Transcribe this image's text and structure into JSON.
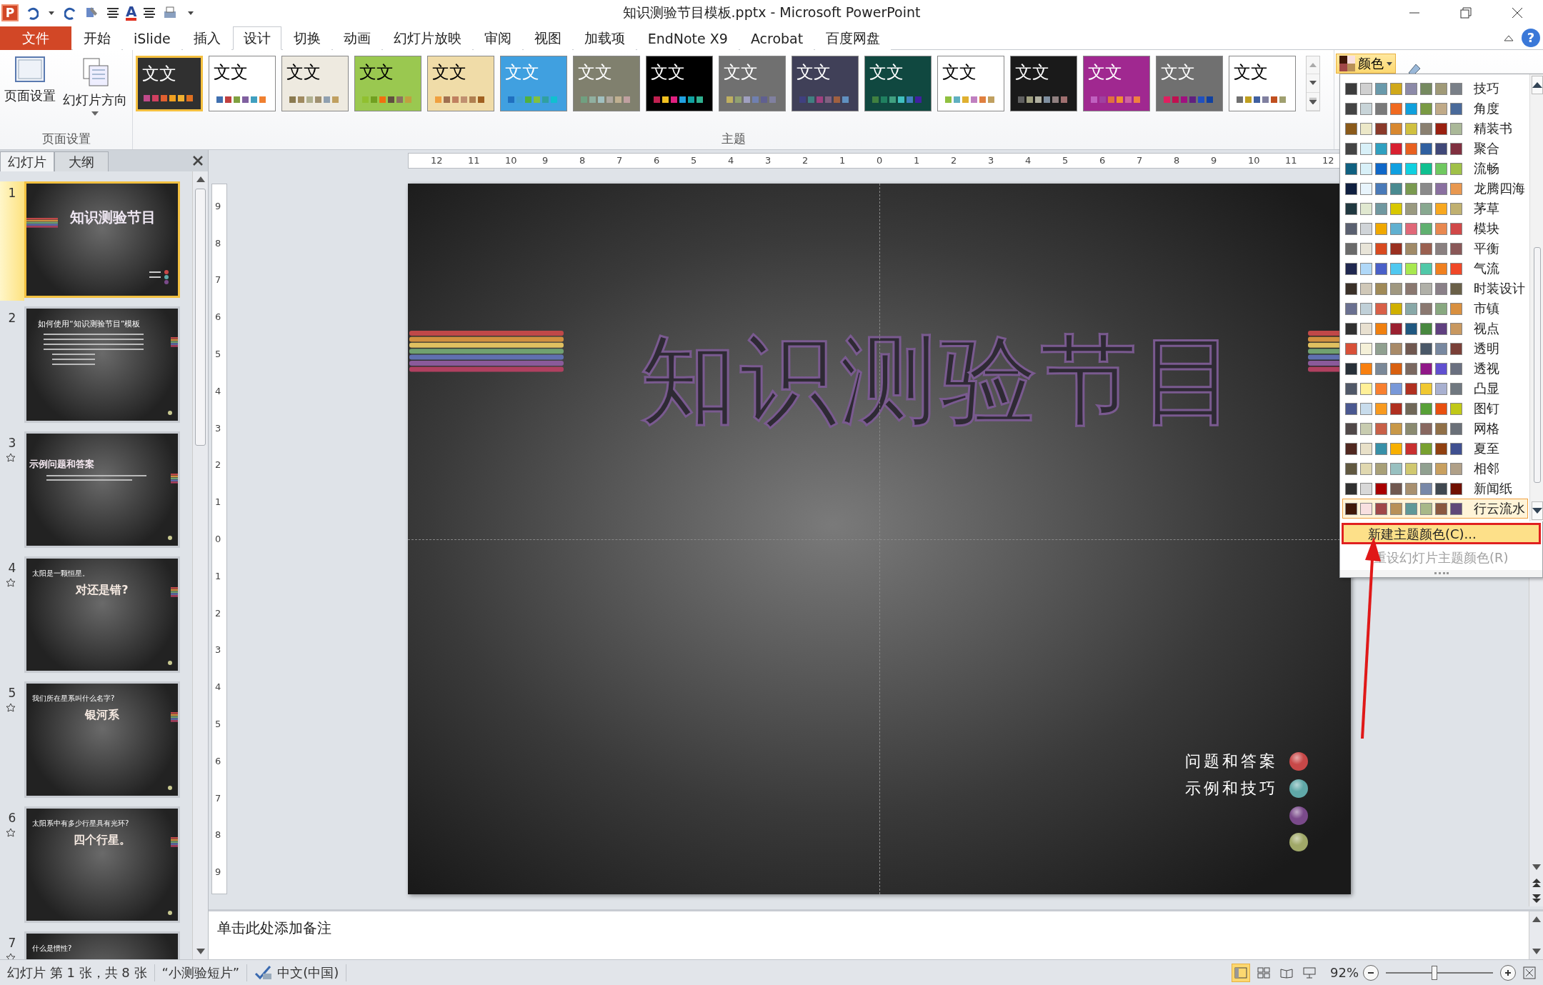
{
  "quick_access": [
    {
      "kind": "logo",
      "letter": "P"
    },
    {
      "kind": "undo"
    },
    {
      "kind": "caret"
    },
    {
      "kind": "redo"
    },
    {
      "kind": "tool"
    },
    {
      "kind": "align"
    },
    {
      "kind": "font-color",
      "letter": "A"
    },
    {
      "kind": "align"
    },
    {
      "kind": "printer"
    },
    {
      "kind": "caret"
    }
  ],
  "window": {
    "title": "知识测验节目模板.pptx - Microsoft PowerPoint",
    "help": "?"
  },
  "tabs": [
    {
      "label": "文件",
      "kind": "file",
      "selected": false
    },
    {
      "label": "开始",
      "kind": "tab",
      "selected": false
    },
    {
      "label": "iSlide",
      "kind": "tab",
      "selected": false
    },
    {
      "label": "插入",
      "kind": "tab",
      "selected": false
    },
    {
      "label": "设计",
      "kind": "tab",
      "selected": true
    },
    {
      "label": "切换",
      "kind": "tab",
      "selected": false
    },
    {
      "label": "动画",
      "kind": "tab",
      "selected": false
    },
    {
      "label": "幻灯片放映",
      "kind": "tab",
      "selected": false
    },
    {
      "label": "审阅",
      "kind": "tab",
      "selected": false
    },
    {
      "label": "视图",
      "kind": "tab",
      "selected": false
    },
    {
      "label": "加载项",
      "kind": "tab",
      "selected": false
    },
    {
      "label": "EndNote X9",
      "kind": "tab",
      "selected": false
    },
    {
      "label": "Acrobat",
      "kind": "tab",
      "selected": false
    },
    {
      "label": "百度网盘",
      "kind": "tab",
      "selected": false
    }
  ],
  "page_setup": {
    "buttons": [
      {
        "label": "页面设置",
        "kind": "setup"
      },
      {
        "label": "幻灯片方向",
        "kind": "orientation"
      }
    ],
    "group_label": "页面设置"
  },
  "themes": {
    "group_label": "主题",
    "items": [
      {
        "label": "文文",
        "selected": true,
        "color": "#303030",
        "swatches": [
          {
            "color": "#c04a8a"
          },
          {
            "color": "#d04060"
          },
          {
            "color": "#e06030"
          },
          {
            "color": "#f0a020"
          },
          {
            "color": "#f0b030"
          },
          {
            "color": "#e07020"
          }
        ]
      },
      {
        "label": "文文",
        "selected": false,
        "color": "#ffffff",
        "swatches": [
          {
            "color": "#4070b0"
          },
          {
            "color": "#c04040"
          },
          {
            "color": "#80a040"
          },
          {
            "color": "#8060a0"
          },
          {
            "color": "#40a0c0"
          },
          {
            "color": "#f08030"
          }
        ]
      },
      {
        "label": "文文",
        "selected": false,
        "color": "#eeeae0",
        "swatches": [
          {
            "color": "#8a7a50"
          },
          {
            "color": "#a08a60"
          },
          {
            "color": "#b0b090"
          },
          {
            "color": "#a09070"
          },
          {
            "color": "#90a0b0"
          },
          {
            "color": "#c0a060"
          }
        ]
      },
      {
        "label": "文文",
        "selected": false,
        "color": "#9ac850",
        "swatches": [
          {
            "color": "#90c030"
          },
          {
            "color": "#70a020"
          },
          {
            "color": "#f07010"
          },
          {
            "color": "#605040"
          },
          {
            "color": "#8a7060"
          },
          {
            "color": "#c0a040"
          }
        ]
      },
      {
        "label": "文文",
        "selected": false,
        "color": "#f0dca8",
        "swatches": [
          {
            "color": "#f0a040"
          },
          {
            "color": "#a07050"
          },
          {
            "color": "#c08060"
          },
          {
            "color": "#c09070"
          },
          {
            "color": "#b08050"
          },
          {
            "color": "#a06020"
          }
        ]
      },
      {
        "label": "文文",
        "selected": false,
        "color": "#40a0e0",
        "swatches": [
          {
            "color": "#2070c0"
          },
          {
            "color": "#40a0d0"
          },
          {
            "color": "#50b040"
          },
          {
            "color": "#80c040"
          },
          {
            "color": "#30a0a0"
          },
          {
            "color": "#10c0d0"
          }
        ]
      },
      {
        "label": "文文",
        "selected": false,
        "color": "#80806e",
        "swatches": [
          {
            "color": "#70a080"
          },
          {
            "color": "#90b0a0"
          },
          {
            "color": "#a0c0c0"
          },
          {
            "color": "#b0a8a0"
          },
          {
            "color": "#c0b090"
          },
          {
            "color": "#c0a0a0"
          }
        ]
      },
      {
        "label": "文文",
        "selected": false,
        "color": "#000000",
        "swatches": [
          {
            "color": "#c02050"
          },
          {
            "color": "#f0c020"
          },
          {
            "color": "#e02080"
          },
          {
            "color": "#20a0e0"
          },
          {
            "color": "#10a0a0"
          },
          {
            "color": "#30b090"
          }
        ]
      },
      {
        "label": "文文",
        "selected": false,
        "color": "#707070",
        "swatches": [
          {
            "color": "#c0b060"
          },
          {
            "color": "#90a070"
          },
          {
            "color": "#a0a0c0"
          },
          {
            "color": "#7080b0"
          },
          {
            "color": "#606090"
          },
          {
            "color": "#8080a0"
          }
        ]
      },
      {
        "label": "文文",
        "selected": false,
        "color": "#404058",
        "swatches": [
          {
            "color": "#404080"
          },
          {
            "color": "#408080"
          },
          {
            "color": "#a04080"
          },
          {
            "color": "#806080"
          },
          {
            "color": "#a06040"
          },
          {
            "color": "#6090c0"
          }
        ]
      },
      {
        "label": "文文",
        "selected": false,
        "color": "#104840",
        "swatches": [
          {
            "color": "#408040"
          },
          {
            "color": "#208060"
          },
          {
            "color": "#40a080"
          },
          {
            "color": "#40c0c0"
          },
          {
            "color": "#4080c0"
          },
          {
            "color": "#4020a0"
          }
        ]
      },
      {
        "label": "文文",
        "selected": false,
        "color": "#ffffff",
        "swatches": [
          {
            "color": "#90c040"
          },
          {
            "color": "#60b0c0"
          },
          {
            "color": "#e0b030"
          },
          {
            "color": "#c080c0"
          },
          {
            "color": "#e08040"
          },
          {
            "color": "#c0a060"
          }
        ]
      },
      {
        "label": "文文",
        "selected": false,
        "color": "#1a1a1a",
        "swatches": [
          {
            "color": "#606060"
          },
          {
            "color": "#a0a080"
          },
          {
            "color": "#b0b0a0"
          },
          {
            "color": "#8090a0"
          },
          {
            "color": "#908080"
          },
          {
            "color": "#a07070"
          }
        ]
      },
      {
        "label": "文文",
        "selected": false,
        "color": "#a02890",
        "swatches": [
          {
            "color": "#c060c0"
          },
          {
            "color": "#a040a0"
          },
          {
            "color": "#e07040"
          },
          {
            "color": "#f09030"
          },
          {
            "color": "#d060a0"
          },
          {
            "color": "#f08040"
          }
        ]
      },
      {
        "label": "文文",
        "selected": false,
        "color": "#707070",
        "swatches": [
          {
            "color": "#e02060"
          },
          {
            "color": "#c01050"
          },
          {
            "color": "#a01080"
          },
          {
            "color": "#602080"
          },
          {
            "color": "#2050c0"
          },
          {
            "color": "#1040a0"
          }
        ]
      },
      {
        "label": "文文",
        "selected": false,
        "color": "#ffffff",
        "swatches": [
          {
            "color": "#707070"
          },
          {
            "color": "#c0a020"
          },
          {
            "color": "#4060a0"
          },
          {
            "color": "#8080a0"
          },
          {
            "color": "#c05020"
          },
          {
            "color": "#a0a070"
          }
        ]
      }
    ]
  },
  "colors_button": {
    "label": "颜色"
  },
  "color_schemes": [
    {
      "name": "技巧",
      "selected": false,
      "colors": [
        {
          "color": "#3c3c3c"
        },
        {
          "color": "#d0d0d0"
        },
        {
          "color": "#6a9aab"
        },
        {
          "color": "#d0a81a"
        },
        {
          "color": "#8c8aa8"
        },
        {
          "color": "#768a60"
        },
        {
          "color": "#a09a78"
        },
        {
          "color": "#7a8088"
        }
      ]
    },
    {
      "name": "角度",
      "selected": false,
      "colors": [
        {
          "color": "#444444"
        },
        {
          "color": "#c8d4d8"
        },
        {
          "color": "#7a7a7a"
        },
        {
          "color": "#f06a20"
        },
        {
          "color": "#10a0dc"
        },
        {
          "color": "#7a9a44"
        },
        {
          "color": "#c0aa88"
        },
        {
          "color": "#4a6a9a"
        }
      ]
    },
    {
      "name": "精装书",
      "selected": false,
      "colors": [
        {
          "color": "#8a5a1a"
        },
        {
          "color": "#ece8c8"
        },
        {
          "color": "#8a3a2a"
        },
        {
          "color": "#d88830"
        },
        {
          "color": "#d0c040"
        },
        {
          "color": "#8a8070"
        },
        {
          "color": "#9a2010"
        },
        {
          "color": "#aab898"
        }
      ]
    },
    {
      "name": "聚合",
      "selected": false,
      "colors": [
        {
          "color": "#444444"
        },
        {
          "color": "#d8f0f8"
        },
        {
          "color": "#30a0c0"
        },
        {
          "color": "#d82030"
        },
        {
          "color": "#e86020"
        },
        {
          "color": "#3060a0"
        },
        {
          "color": "#404878"
        },
        {
          "color": "#803040"
        }
      ]
    },
    {
      "name": "流畅",
      "selected": false,
      "colors": [
        {
          "color": "#106080"
        },
        {
          "color": "#d8f0f8"
        },
        {
          "color": "#1068c8"
        },
        {
          "color": "#10a0e0"
        },
        {
          "color": "#10d0e0"
        },
        {
          "color": "#10c090"
        },
        {
          "color": "#70c860"
        },
        {
          "color": "#a0c048"
        }
      ]
    },
    {
      "name": "龙腾四海",
      "selected": false,
      "colors": [
        {
          "color": "#102040"
        },
        {
          "color": "#e8f4fc"
        },
        {
          "color": "#4a7ab8"
        },
        {
          "color": "#4a8a90"
        },
        {
          "color": "#7a9a50"
        },
        {
          "color": "#8a8a8a"
        },
        {
          "color": "#8a70a0"
        },
        {
          "color": "#e89850"
        }
      ]
    },
    {
      "name": "茅草",
      "selected": false,
      "colors": [
        {
          "color": "#203840"
        },
        {
          "color": "#e0e8d0"
        },
        {
          "color": "#7098a0"
        },
        {
          "color": "#d8c800"
        },
        {
          "color": "#9a9a80"
        },
        {
          "color": "#88a890"
        },
        {
          "color": "#f8a820"
        },
        {
          "color": "#c0b070"
        }
      ]
    },
    {
      "name": "模块",
      "selected": false,
      "colors": [
        {
          "color": "#5a6070"
        },
        {
          "color": "#d0d4d8"
        },
        {
          "color": "#f0a800"
        },
        {
          "color": "#60b0d0"
        },
        {
          "color": "#e06878"
        },
        {
          "color": "#60b070"
        },
        {
          "color": "#e88850"
        },
        {
          "color": "#d04848"
        }
      ]
    },
    {
      "name": "平衡",
      "selected": false,
      "colors": [
        {
          "color": "#6a6a6a"
        },
        {
          "color": "#e8e4d8"
        },
        {
          "color": "#d84a20"
        },
        {
          "color": "#9a3020"
        },
        {
          "color": "#a08a68"
        },
        {
          "color": "#9a6050"
        },
        {
          "color": "#8a8080"
        },
        {
          "color": "#8a5858"
        }
      ]
    },
    {
      "name": "气流",
      "selected": false,
      "colors": [
        {
          "color": "#202850"
        },
        {
          "color": "#b0d8f8"
        },
        {
          "color": "#4a60c8"
        },
        {
          "color": "#50c8f0"
        },
        {
          "color": "#a8e850"
        },
        {
          "color": "#50c8a8"
        },
        {
          "color": "#f08020"
        },
        {
          "color": "#f04828"
        }
      ]
    },
    {
      "name": "时装设计",
      "selected": false,
      "colors": [
        {
          "color": "#3a3028"
        },
        {
          "color": "#d0c8b8"
        },
        {
          "color": "#a08a58"
        },
        {
          "color": "#a09880"
        },
        {
          "color": "#8a7870"
        },
        {
          "color": "#b0b0a8"
        },
        {
          "color": "#8a8088"
        },
        {
          "color": "#6a6048"
        }
      ]
    },
    {
      "name": "市镇",
      "selected": false,
      "colors": [
        {
          "color": "#6a7090"
        },
        {
          "color": "#c0d0d8"
        },
        {
          "color": "#d86048"
        },
        {
          "color": "#d0b000"
        },
        {
          "color": "#88a8a8"
        },
        {
          "color": "#8a7870"
        },
        {
          "color": "#88a880"
        },
        {
          "color": "#d89040"
        }
      ]
    },
    {
      "name": "视点",
      "selected": false,
      "colors": [
        {
          "color": "#303030"
        },
        {
          "color": "#e8e0d0"
        },
        {
          "color": "#f08010"
        },
        {
          "color": "#9a2030"
        },
        {
          "color": "#205880"
        },
        {
          "color": "#488840"
        },
        {
          "color": "#604080"
        },
        {
          "color": "#c89860"
        }
      ]
    },
    {
      "name": "透明",
      "selected": false,
      "colors": [
        {
          "color": "#d85038"
        },
        {
          "color": "#f4f0d8"
        },
        {
          "color": "#90a090"
        },
        {
          "color": "#a88a68"
        },
        {
          "color": "#705850"
        },
        {
          "color": "#4a5868"
        },
        {
          "color": "#7888a0"
        },
        {
          "color": "#7a4038"
        }
      ]
    },
    {
      "name": "透视",
      "selected": false,
      "colors": [
        {
          "color": "#283038"
        },
        {
          "color": "#f88010"
        },
        {
          "color": "#7a8898"
        },
        {
          "color": "#d86010"
        },
        {
          "color": "#7a6860"
        },
        {
          "color": "#901888"
        },
        {
          "color": "#6050d0"
        },
        {
          "color": "#6a7080"
        }
      ]
    },
    {
      "name": "凸显",
      "selected": false,
      "colors": [
        {
          "color": "#505868"
        },
        {
          "color": "#fff098"
        },
        {
          "color": "#f88030"
        },
        {
          "color": "#7898d8"
        },
        {
          "color": "#b03020"
        },
        {
          "color": "#f0c830"
        },
        {
          "color": "#a8b0d0"
        },
        {
          "color": "#707880"
        }
      ]
    },
    {
      "name": "图钉",
      "selected": false,
      "colors": [
        {
          "color": "#4a5890"
        },
        {
          "color": "#c8dcec"
        },
        {
          "color": "#f89a20"
        },
        {
          "color": "#b03020"
        },
        {
          "color": "#706858"
        },
        {
          "color": "#58a038"
        },
        {
          "color": "#e85010"
        },
        {
          "color": "#c0c818"
        }
      ]
    },
    {
      "name": "网格",
      "selected": false,
      "colors": [
        {
          "color": "#504848"
        },
        {
          "color": "#c8ccb0"
        },
        {
          "color": "#c86048"
        },
        {
          "color": "#c89848"
        },
        {
          "color": "#8a8a70"
        },
        {
          "color": "#886860"
        },
        {
          "color": "#907048"
        },
        {
          "color": "#6a7078"
        }
      ]
    },
    {
      "name": "夏至",
      "selected": false,
      "colors": [
        {
          "color": "#502820"
        },
        {
          "color": "#e8e0c8"
        },
        {
          "color": "#3890a8"
        },
        {
          "color": "#f8b000"
        },
        {
          "color": "#c83030"
        },
        {
          "color": "#78a030"
        },
        {
          "color": "#904010"
        },
        {
          "color": "#405090"
        }
      ]
    },
    {
      "name": "相邻",
      "selected": false,
      "colors": [
        {
          "color": "#605840"
        },
        {
          "color": "#e0d8b0"
        },
        {
          "color": "#a8a078"
        },
        {
          "color": "#98c0c0"
        },
        {
          "color": "#d0c870"
        },
        {
          "color": "#90a090"
        },
        {
          "color": "#c8a060"
        },
        {
          "color": "#b0a088"
        }
      ]
    },
    {
      "name": "新闻纸",
      "selected": false,
      "colors": [
        {
          "color": "#303030"
        },
        {
          "color": "#d8d8d8"
        },
        {
          "color": "#a80000"
        },
        {
          "color": "#705850"
        },
        {
          "color": "#a89070"
        },
        {
          "color": "#7888a8"
        },
        {
          "color": "#404850"
        },
        {
          "color": "#701000"
        }
      ]
    },
    {
      "name": "行云流水",
      "selected": true,
      "colors": [
        {
          "color": "#401808"
        },
        {
          "color": "#f8e0e0"
        },
        {
          "color": "#a04848"
        },
        {
          "color": "#b89058"
        },
        {
          "color": "#609898"
        },
        {
          "color": "#a8b888"
        },
        {
          "color": "#8a5840"
        },
        {
          "color": "#604878"
        }
      ]
    }
  ],
  "menu_actions": [
    {
      "label": "新建主题颜色(C)...",
      "highlighted": true,
      "annotated": true,
      "disabled": false
    },
    {
      "label": "重设幻灯片主题颜色(R)",
      "highlighted": false,
      "annotated": false,
      "disabled": true
    }
  ],
  "panel": {
    "tabs": [
      {
        "label": "幻灯片",
        "selected": true
      },
      {
        "label": "大纲",
        "selected": false
      }
    ]
  },
  "slides": [
    {
      "number": "1",
      "selected": true,
      "animated": false,
      "kind": "title",
      "heading": "知识测验节目"
    },
    {
      "number": "2",
      "selected": false,
      "animated": false,
      "kind": "bullets",
      "heading": "如何使用“知识测验节目”模板"
    },
    {
      "number": "3",
      "selected": false,
      "animated": true,
      "kind": "section",
      "heading": "示例问题和答案"
    },
    {
      "number": "4",
      "selected": false,
      "animated": true,
      "kind": "question",
      "heading": "太阳是一颗恒星。",
      "answer": "对还是错?"
    },
    {
      "number": "5",
      "selected": false,
      "animated": true,
      "kind": "question",
      "heading": "我们所在星系叫什么名字?",
      "answer": "银河系"
    },
    {
      "number": "6",
      "selected": false,
      "animated": true,
      "kind": "question",
      "heading": "太阳系中有多少行星具有光环?",
      "answer": "四个行星。"
    },
    {
      "number": "7",
      "selected": false,
      "animated": true,
      "kind": "question",
      "heading": "什么是惯性?"
    }
  ],
  "ruler": {
    "horizontal": [
      "12",
      "11",
      "10",
      "9",
      "8",
      "7",
      "6",
      "5",
      "4",
      "3",
      "2",
      "1",
      "0",
      "1",
      "2",
      "3",
      "4",
      "5",
      "6",
      "7",
      "8",
      "9",
      "10",
      "11",
      "12"
    ],
    "vertical": [
      "9",
      "8",
      "7",
      "6",
      "5",
      "4",
      "3",
      "2",
      "1",
      "0",
      "1",
      "2",
      "3",
      "4",
      "5",
      "6",
      "7",
      "8",
      "9"
    ]
  },
  "slide": {
    "title": "知识测验节目",
    "legend": [
      {
        "label": "问题和答案",
        "color": "#c84848"
      },
      {
        "label": "示例和技巧",
        "color": "#60a8a8"
      },
      {
        "color": "#7a4a8a"
      },
      {
        "color": "#a0a868"
      }
    ]
  },
  "notes": {
    "placeholder": "单击此处添加备注"
  },
  "status_bar": {
    "slide_info": "幻灯片 第 1 张，共 8 张",
    "theme": "“小测验短片”",
    "language": "中文(中国)",
    "views": [
      {
        "kind": "normal",
        "selected": true
      },
      {
        "kind": "sorter",
        "selected": false
      },
      {
        "kind": "reading",
        "selected": false
      },
      {
        "kind": "slideshow",
        "selected": false
      }
    ],
    "zoom": "92%",
    "zoom_slider": {
      "level": 0.45
    }
  }
}
